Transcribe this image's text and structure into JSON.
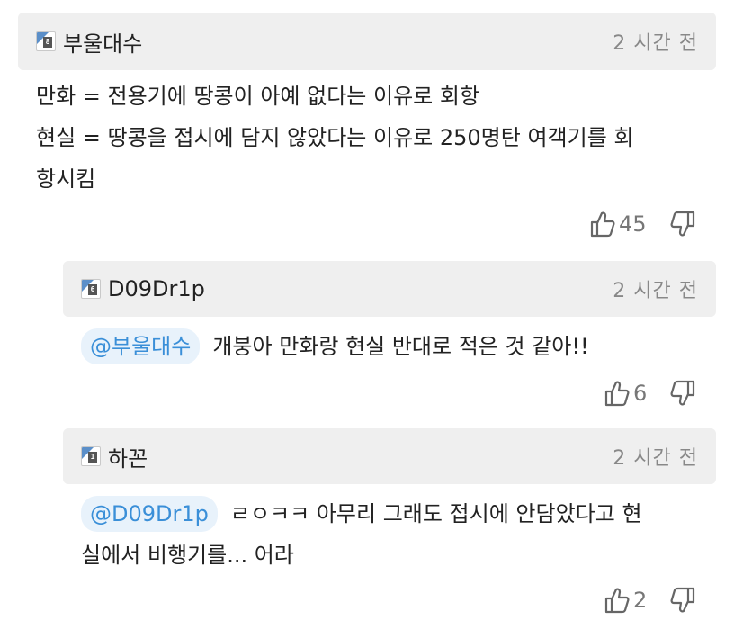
{
  "comments": [
    {
      "level": "8",
      "nickname": "부울대수",
      "time": "2 시간 전",
      "lines": [
        "만화 = 전용기에 땅콩이 아예 없다는 이유로 회항",
        "현실 = 땅콩을 접시에 담지 않았다는 이유로 250명탄 여객기를 회",
        "항시킴"
      ],
      "likes": "45"
    },
    {
      "level": "6",
      "nickname": "D09Dr1p",
      "time": "2 시간 전",
      "mention": "@부울대수",
      "lines": [
        "개붕아 만화랑 현실 반대로 적은 것 같아!!"
      ],
      "likes": "6"
    },
    {
      "level": "1",
      "nickname": "하꼰",
      "time": "2 시간 전",
      "mention": "@D09Dr1p",
      "lines": [
        "ㄹㅇㅋㅋ 아무리 그래도 접시에 안담았다고 현",
        "실에서 비행기를... 어라"
      ],
      "likes": "2"
    }
  ]
}
